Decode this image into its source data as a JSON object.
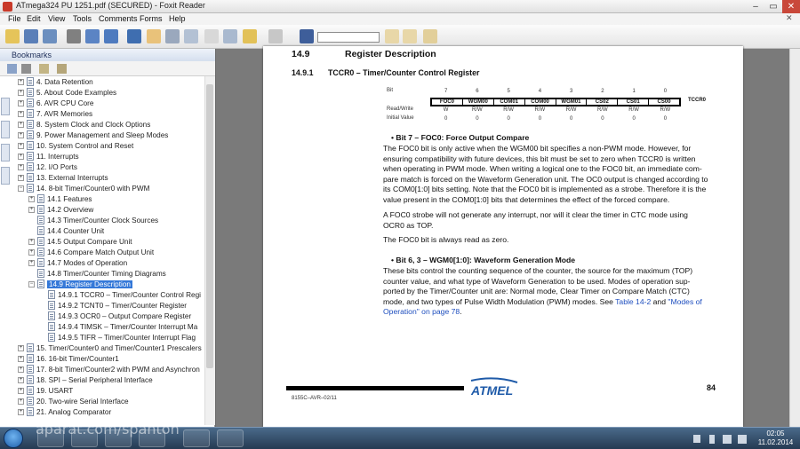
{
  "window": {
    "title": "ATmega324 PU 1251.pdf (SECURED) - Foxit Reader",
    "controls": [
      "–",
      "▭",
      "✕"
    ]
  },
  "menu": [
    "File",
    "Edit",
    "View",
    "Tools",
    "Comments",
    "Forms",
    "Help"
  ],
  "toolbar": {
    "find_value": ""
  },
  "sidebar": {
    "panel_title": "Bookmarks",
    "items": [
      {
        "label": "4. Data Retention",
        "level": 1,
        "expand": "+"
      },
      {
        "label": "5. About Code Examples",
        "level": 1,
        "expand": "+"
      },
      {
        "label": "6. AVR CPU Core",
        "level": 1,
        "expand": "+"
      },
      {
        "label": "7. AVR Memories",
        "level": 1,
        "expand": "+"
      },
      {
        "label": "8. System Clock and Clock Options",
        "level": 1,
        "expand": "+"
      },
      {
        "label": "9. Power Management and Sleep Modes",
        "level": 1,
        "expand": "+"
      },
      {
        "label": "10. System Control and Reset",
        "level": 1,
        "expand": "+"
      },
      {
        "label": "11. Interrupts",
        "level": 1,
        "expand": "+"
      },
      {
        "label": "12. I/O Ports",
        "level": 1,
        "expand": "+"
      },
      {
        "label": "13. External Interrupts",
        "level": 1,
        "expand": "+"
      },
      {
        "label": "14. 8-bit Timer/Counter0 with PWM",
        "level": 1,
        "expand": "−"
      },
      {
        "label": "14.1 Features",
        "level": 2,
        "expand": "+"
      },
      {
        "label": "14.2 Overview",
        "level": 2,
        "expand": "+"
      },
      {
        "label": "14.3 Timer/Counter Clock Sources",
        "level": 2,
        "expand": ""
      },
      {
        "label": "14.4 Counter Unit",
        "level": 2,
        "expand": ""
      },
      {
        "label": "14.5 Output Compare Unit",
        "level": 2,
        "expand": "+"
      },
      {
        "label": "14.6 Compare Match Output Unit",
        "level": 2,
        "expand": "+"
      },
      {
        "label": "14.7 Modes of Operation",
        "level": 2,
        "expand": "+"
      },
      {
        "label": "14.8 Timer/Counter Timing Diagrams",
        "level": 2,
        "expand": ""
      },
      {
        "label": "14.9 Register Description",
        "level": 2,
        "expand": "−",
        "selected": true
      },
      {
        "label": "14.9.1 TCCR0 – Timer/Counter Control Regi",
        "level": 3,
        "expand": ""
      },
      {
        "label": "14.9.2 TCNT0 – Timer/Counter Register",
        "level": 3,
        "expand": ""
      },
      {
        "label": "14.9.3 OCR0 – Output Compare Register",
        "level": 3,
        "expand": ""
      },
      {
        "label": "14.9.4 TIMSK – Timer/Counter Interrupt Ma",
        "level": 3,
        "expand": ""
      },
      {
        "label": "14.9.5 TIFR – Timer/Counter Interrupt Flag",
        "level": 3,
        "expand": ""
      },
      {
        "label": "15. Timer/Counter0 and Timer/Counter1 Prescalers",
        "level": 1,
        "expand": "+"
      },
      {
        "label": "16. 16-bit Timer/Counter1",
        "level": 1,
        "expand": "+"
      },
      {
        "label": "17. 8-bit Timer/Counter2 with PWM and Asynchron",
        "level": 1,
        "expand": "+"
      },
      {
        "label": "18. SPI – Serial Peripheral Interface",
        "level": 1,
        "expand": "+"
      },
      {
        "label": "19. USART",
        "level": 1,
        "expand": "+"
      },
      {
        "label": "20. Two-wire Serial Interface",
        "level": 1,
        "expand": "+"
      },
      {
        "label": "21. Analog Comparator",
        "level": 1,
        "expand": "+"
      }
    ]
  },
  "document": {
    "section_num": "14.9",
    "section_title": "Register Description",
    "subsection_num": "14.9.1",
    "subsection_title": "TCCR0 – Timer/Counter Control Register",
    "register": {
      "row_labels": [
        "Bit",
        "Read/Write",
        "Initial Value"
      ],
      "bit_numbers": [
        "7",
        "6",
        "5",
        "4",
        "3",
        "2",
        "1",
        "0"
      ],
      "bits": [
        "FOC0",
        "WGM00",
        "COM01",
        "COM00",
        "WGM01",
        "CS02",
        "CS01",
        "CS00"
      ],
      "rw": [
        "W",
        "R/W",
        "R/W",
        "R/W",
        "R/W",
        "R/W",
        "R/W",
        "R/W"
      ],
      "initial": [
        "0",
        "0",
        "0",
        "0",
        "0",
        "0",
        "0",
        "0"
      ],
      "name": "TCCR0"
    },
    "bit7_heading": "Bit 7 – FOC0: Force Output Compare",
    "bit7_lines": [
      "The FOC0 bit is only active when the WGM00 bit specifies a non-PWM mode. However, for",
      "ensuring compatibility with future devices, this bit must be set to zero when TCCR0 is written",
      "when operating in PWM mode. When writing a logical one to the FOC0 bit, an immediate com-",
      "pare match is forced on the Waveform Generation unit. The OC0 output is changed according to",
      "its COM0[1:0] bits setting. Note that the FOC0 bit is implemented as a strobe. Therefore it is the",
      "value present in the COM0[1:0] bits that determines the effect of the forced compare."
    ],
    "bit7_p2": [
      "A FOC0 strobe will not generate any interrupt, nor will it clear the timer in CTC mode using",
      "OCR0 as TOP."
    ],
    "bit7_p3": "The FOC0 bit is always read as zero.",
    "bit63_heading": "Bit 6, 3 – WGM0[1:0]: Waveform Generation Mode",
    "bit63_lines": [
      "These bits control the counting sequence of the counter, the source for the maximum (TOP)",
      "counter value, and what type of Waveform Generation to be used. Modes of operation sup-",
      "ported by the Timer/Counter unit are: Normal mode, Clear Timer on Compare Match (CTC)"
    ],
    "bit63_line4_a": "mode, and two types of Pulse Width Modulation (PWM) modes. See ",
    "bit63_link1": "Table 14-2",
    "bit63_line4_b": " and ",
    "bit63_link2": "\"Modes of",
    "bit63_link3": "Operation\" on page 78",
    "bit63_end": ".",
    "footer_doc": "8155C–AVR–02/11",
    "page_number": "84",
    "logo": "ATMEL"
  },
  "taskbar": {
    "time": "02:05",
    "date": "11.02.2014"
  },
  "watermark": "aparat.com/spanton"
}
